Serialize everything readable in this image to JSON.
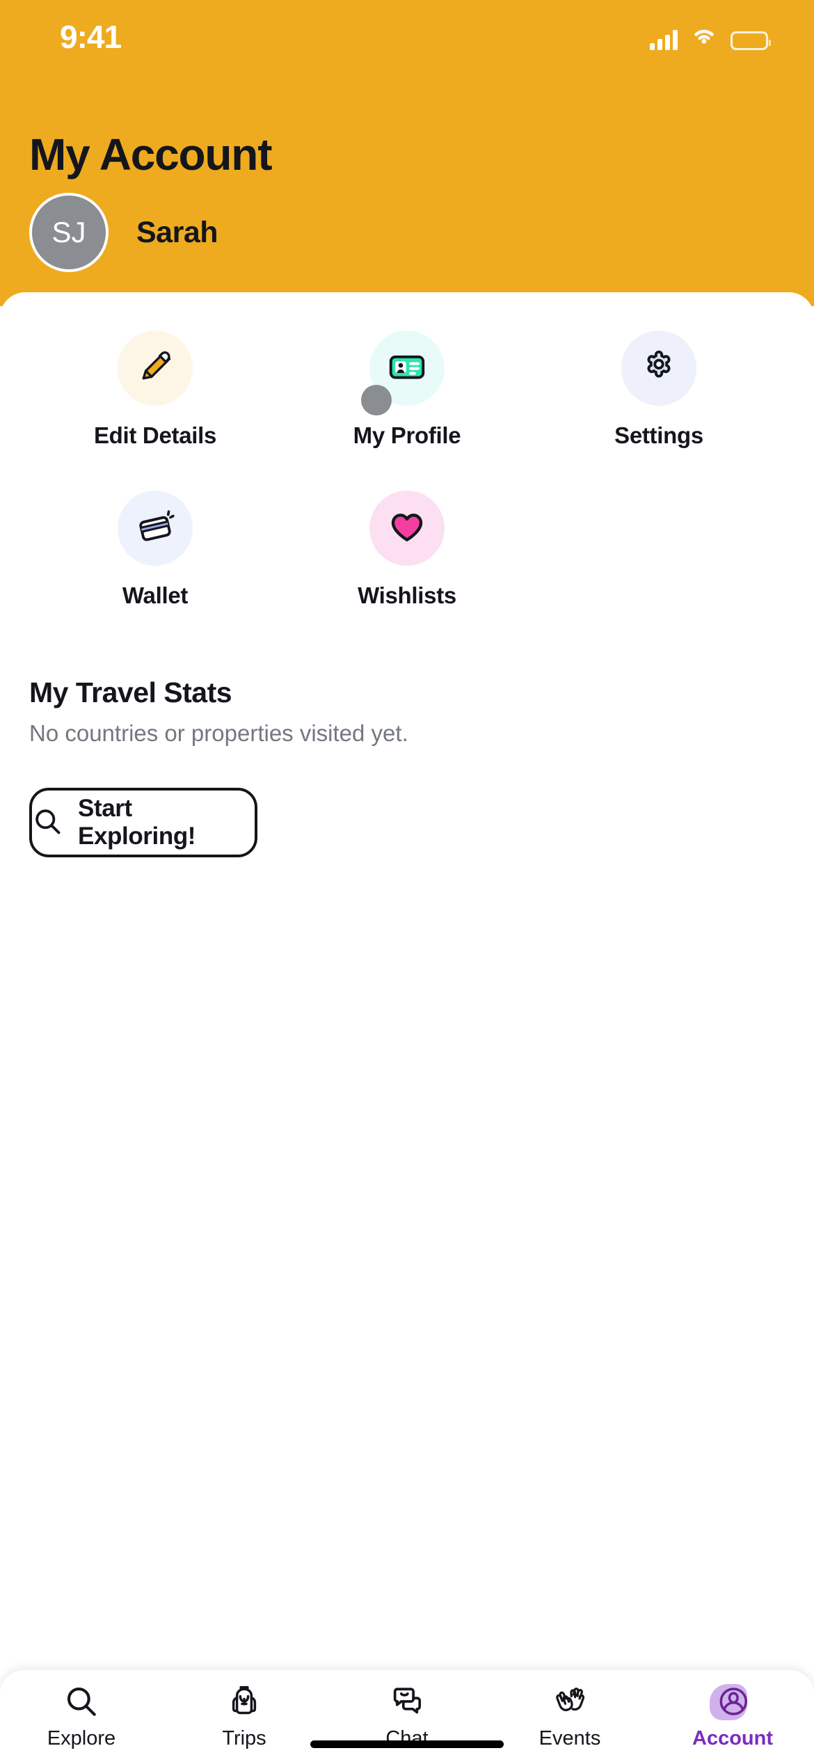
{
  "status_bar": {
    "time": "9:41",
    "cellular_icon": "cellular-signal-icon",
    "wifi_icon": "wifi-icon",
    "battery_icon": "battery-icon"
  },
  "header": {
    "title": "My Account",
    "background_color": "#eeab20",
    "user": {
      "initials": "SJ",
      "name": "Sarah",
      "avatar_background": "#8a8d91"
    }
  },
  "actions": [
    {
      "label": "Edit Details",
      "icon": "pencil-icon",
      "bubble_color": "#fdf6e6",
      "accent": "#efab24"
    },
    {
      "label": "My Profile",
      "icon": "id-card-icon",
      "bubble_color": "#e8fbf8",
      "accent": "#2ee3b0",
      "badge": true
    },
    {
      "label": "Settings",
      "icon": "gear-icon",
      "bubble_color": "#eef0fb",
      "accent": "#d9e2f5"
    },
    {
      "label": "Wallet",
      "icon": "credit-card-icon",
      "bubble_color": "#eef2fd",
      "accent": "#9aaae8"
    },
    {
      "label": "Wishlists",
      "icon": "heart-icon",
      "bubble_color": "#fce0f2",
      "accent": "#f43fa0"
    }
  ],
  "stats": {
    "title": "My Travel Stats",
    "empty_message": "No countries or properties visited yet.",
    "cta_label": "Start Exploring!",
    "cta_icon": "search-icon"
  },
  "tabbar": {
    "active": "Account",
    "active_color": "#7b2cbf",
    "items": [
      {
        "label": "Explore",
        "icon": "search-icon"
      },
      {
        "label": "Trips",
        "icon": "backpack-icon"
      },
      {
        "label": "Chat",
        "icon": "chat-bubbles-icon"
      },
      {
        "label": "Events",
        "icon": "high-five-hands-icon"
      },
      {
        "label": "Account",
        "icon": "user-circle-icon"
      }
    ]
  }
}
